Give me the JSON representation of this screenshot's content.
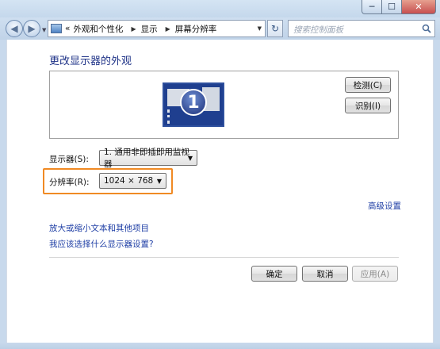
{
  "window": {
    "controls": {
      "minimize": "─",
      "maximize": "☐",
      "close": "✕"
    }
  },
  "navigation": {
    "back": "◀",
    "forward": "▶",
    "dropdown": "▼",
    "breadcrumb_prefix": "«",
    "breadcrumbs": [
      "外观和个性化",
      "显示",
      "屏幕分辨率"
    ],
    "separator": "▶",
    "refresh": "↻",
    "search_placeholder": "搜索控制面板"
  },
  "main": {
    "title": "更改显示器的外观",
    "monitor_number": "1",
    "detect_button": "检测(C)",
    "identify_button": "识别(I)",
    "display_label": "显示器(S):",
    "display_value": "1. 通用非即插即用监视器",
    "resolution_label": "分辨率(R):",
    "resolution_value": "1024 × 768",
    "advanced_link": "高级设置",
    "link_text_size": "放大或缩小文本和其他项目",
    "link_which_setting": "我应该选择什么显示器设置?",
    "ok_button": "确定",
    "cancel_button": "取消",
    "apply_button": "应用(A)"
  },
  "colors": {
    "heading": "#1e3287",
    "link": "#1e3ea5",
    "highlight": "#f08a24",
    "monitor_bg": "#1f3f8f"
  }
}
